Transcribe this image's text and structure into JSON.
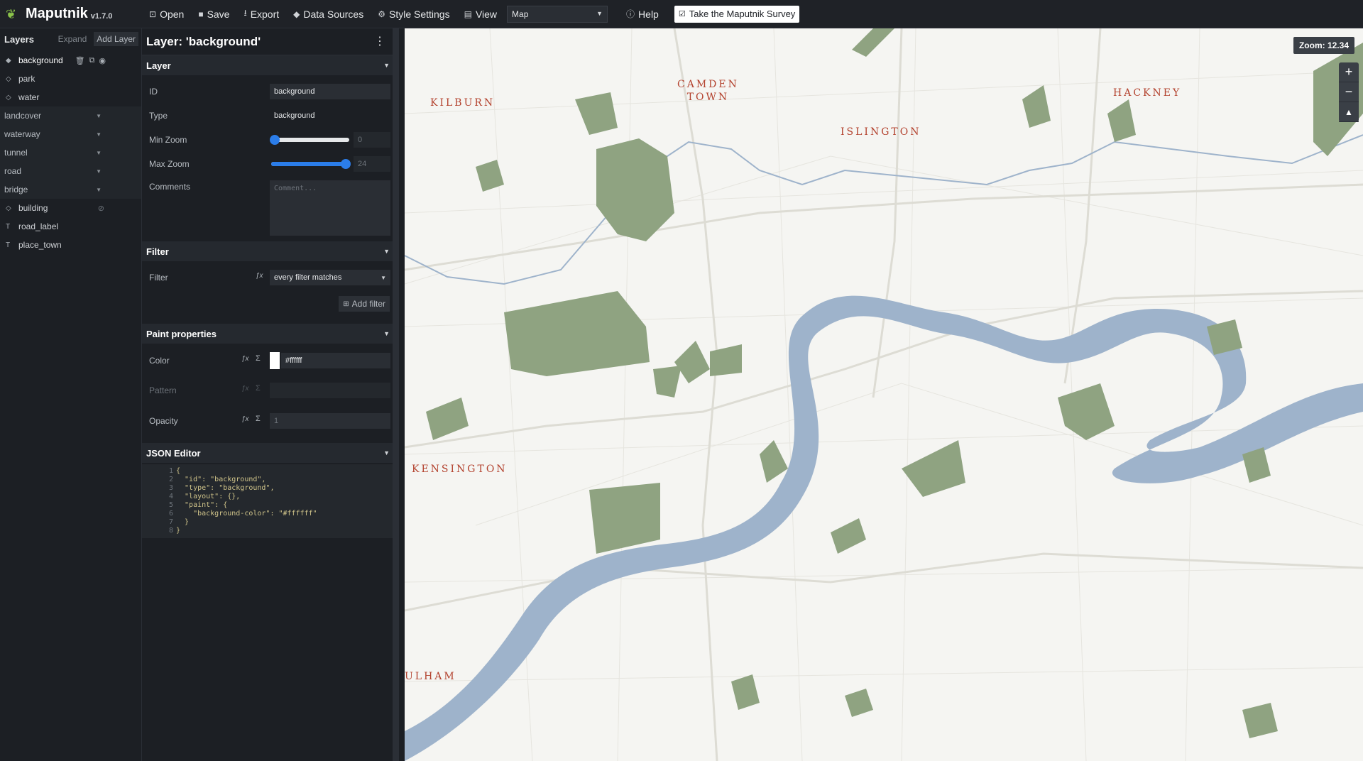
{
  "app": {
    "name": "Maputnik",
    "version": "v1.7.0"
  },
  "toolbar": {
    "open": "Open",
    "save": "Save",
    "export": "Export",
    "data_sources": "Data Sources",
    "style_settings": "Style Settings",
    "view": "View",
    "view_value": "Map",
    "help": "Help",
    "survey": "Take the Maputnik Survey"
  },
  "layers_panel": {
    "title": "Layers",
    "expand": "Expand",
    "add_layer": "Add Layer",
    "items": [
      {
        "label": "background",
        "kind": "layer"
      },
      {
        "label": "park",
        "kind": "layer"
      },
      {
        "label": "water",
        "kind": "layer"
      },
      {
        "label": "landcover",
        "kind": "group"
      },
      {
        "label": "waterway",
        "kind": "group"
      },
      {
        "label": "tunnel",
        "kind": "group"
      },
      {
        "label": "road",
        "kind": "group"
      },
      {
        "label": "bridge",
        "kind": "group"
      },
      {
        "label": "building",
        "kind": "layer"
      },
      {
        "label": "road_label",
        "kind": "symbol"
      },
      {
        "label": "place_town",
        "kind": "symbol"
      }
    ]
  },
  "editor": {
    "title": "Layer: 'background'",
    "layer_section": "Layer",
    "id_label": "ID",
    "id_value": "background",
    "type_label": "Type",
    "type_value": "background",
    "minzoom_label": "Min Zoom",
    "minzoom_value": "0",
    "maxzoom_label": "Max Zoom",
    "maxzoom_value": "24",
    "comments_label": "Comments",
    "comments_placeholder": "Comment...",
    "filter_section": "Filter",
    "filter_label": "Filter",
    "filter_value": "every filter matches",
    "add_filter": "Add filter",
    "paint_section": "Paint properties",
    "color_label": "Color",
    "color_value": "#ffffff",
    "pattern_label": "Pattern",
    "opacity_label": "Opacity",
    "opacity_placeholder": "1",
    "json_section": "JSON Editor",
    "json_lines": [
      "1",
      "2",
      "3",
      "4",
      "5",
      "6",
      "7",
      "8"
    ],
    "json_code": "{\n  \"id\": \"background\",\n  \"type\": \"background\",\n  \"layout\": {},\n  \"paint\": {\n    \"background-color\": \"#ffffff\"\n  }\n}"
  },
  "map": {
    "zoom_label": "Zoom: 12.34",
    "zoom_in": "+",
    "zoom_out": "−",
    "places": {
      "kilburn": "KILBURN",
      "camden": "CAMDEN\nTOWN",
      "islington": "ISLINGTON",
      "hackney": "HACKNEY",
      "kensington": "KENSINGTON",
      "fulham": "ULHAM"
    },
    "colors": {
      "land": "#f5f5f2",
      "water": "#9eb3cb",
      "park": "#8fa381",
      "label": "#b3422e"
    }
  }
}
